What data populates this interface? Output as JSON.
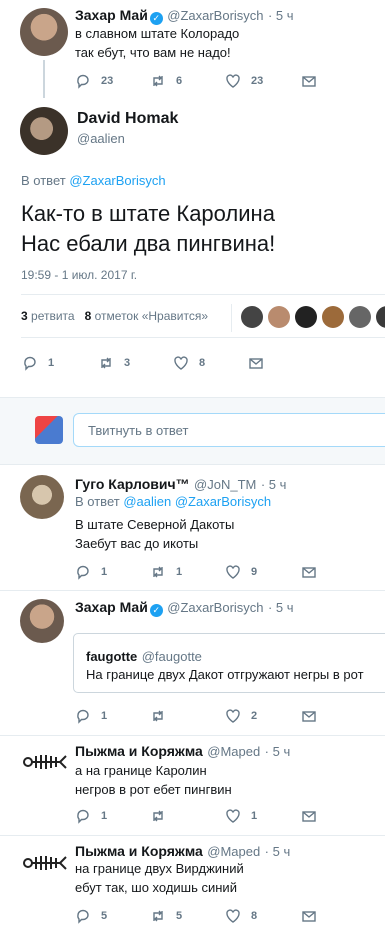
{
  "tweet1": {
    "name": "Захар Май",
    "handle": "@ZaxarBorisych",
    "time": "· 5 ч",
    "lines": [
      "в славном штате Колорадо",
      "так ебут, что вам не надо!"
    ],
    "replies": "23",
    "retweets": "6",
    "likes": "23"
  },
  "main": {
    "name": "David Homak",
    "handle": "@aalien",
    "reply_prefix": "В ответ",
    "reply_to": "@ZaxarBorisych",
    "lines": [
      "Как-то в штате Каролина",
      "Нас ебали два пингвина!"
    ],
    "timestamp": "19:59 - 1 июл. 2017 г.",
    "retweets_count": "3",
    "retweets_label": "ретвита",
    "likes_count": "8",
    "likes_label": "отметок «Нравится»",
    "replies": "1",
    "retweets": "3",
    "likes": "8"
  },
  "reply_box": {
    "placeholder": "Твитнуть в ответ"
  },
  "reply1": {
    "name": "Гуго Карлович™",
    "handle": "@JoN_TM",
    "time": "· 5 ч",
    "reply_prefix": "В ответ",
    "reply_to": "@aalien @ZaxarBorisych",
    "lines": [
      "В штате Северной Дакоты",
      "Заебут вас до икоты"
    ],
    "replies": "1",
    "retweets": "1",
    "likes": "9"
  },
  "reply2": {
    "name": "Захар Май",
    "handle": "@ZaxarBorisych",
    "time": "· 5 ч",
    "quote_name": "faugotte",
    "quote_handle": "@faugotte",
    "quote_text": "На границе двух Дакот отгружают негры в рот",
    "replies": "1",
    "retweets": "",
    "likes": "2"
  },
  "reply3": {
    "name": "Пыжма и Коряжма",
    "handle": "@Maped",
    "time": "· 5 ч",
    "lines": [
      "а на границе Каролин",
      "негров в рот ебет пингвин"
    ],
    "replies": "1",
    "retweets": "",
    "likes": "1"
  },
  "reply4": {
    "name": "Пыжма и Коряжма",
    "handle": "@Maped",
    "time": "· 5 ч",
    "lines": [
      "на границе двух Вирджиний",
      "ебут так, шо ходишь синий"
    ],
    "replies": "5",
    "retweets": "5",
    "likes": "8"
  }
}
